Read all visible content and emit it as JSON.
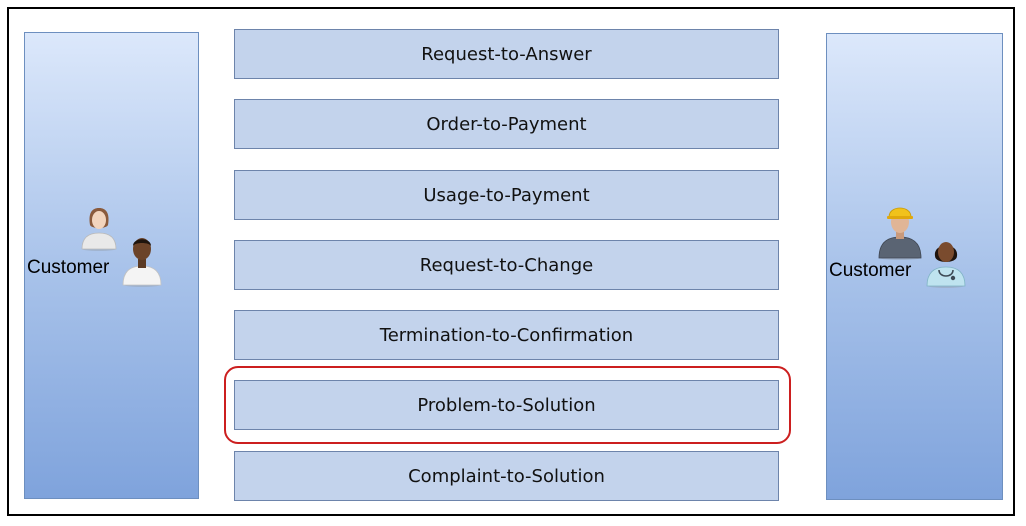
{
  "left_panel": {
    "label": "Customer",
    "icons": [
      "woman-avatar-icon",
      "man-avatar-icon"
    ]
  },
  "right_panel": {
    "label": "Customer",
    "icons": [
      "worker-hardhat-avatar-icon",
      "doctor-stethoscope-avatar-icon"
    ]
  },
  "processes": [
    {
      "label": "Request-to-Answer"
    },
    {
      "label": "Order-to-Payment"
    },
    {
      "label": "Usage-to-Payment"
    },
    {
      "label": "Request-to-Change"
    },
    {
      "label": "Termination-to-Confirmation"
    },
    {
      "label": "Problem-to-Solution",
      "highlighted": true
    },
    {
      "label": "Complaint-to-Solution"
    }
  ],
  "colors": {
    "panel_gradient_top": "#dce8fb",
    "panel_gradient_bottom": "#7fa3dc",
    "process_fill": "#c3d3ec",
    "process_border": "#6d84ab",
    "highlight": "#cc1f1f"
  }
}
